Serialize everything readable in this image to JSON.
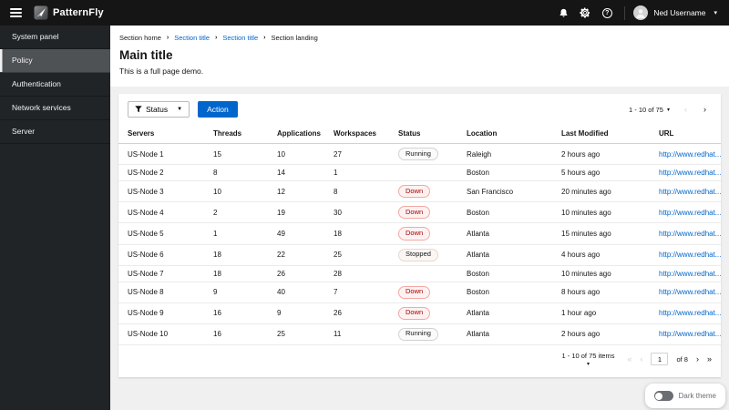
{
  "masthead": {
    "brand": "PatternFly",
    "user": {
      "name": "Ned Username"
    }
  },
  "sidebar": {
    "items": [
      {
        "label": "System panel",
        "selected": false
      },
      {
        "label": "Policy",
        "selected": true
      },
      {
        "label": "Authentication",
        "selected": false
      },
      {
        "label": "Network services",
        "selected": false
      },
      {
        "label": "Server",
        "selected": false
      }
    ]
  },
  "breadcrumb": {
    "separator": "›",
    "items": [
      {
        "label": "Section home",
        "link": false
      },
      {
        "label": "Section title",
        "link": true
      },
      {
        "label": "Section title",
        "link": true
      },
      {
        "label": "Section landing",
        "link": false
      }
    ]
  },
  "page": {
    "title": "Main title",
    "subtitle": "This is a full page demo."
  },
  "toolbar": {
    "filter_label": "Status",
    "action_label": "Action"
  },
  "pagination_top": {
    "range": "1 - 10 of 75",
    "prev": "‹",
    "next": "›"
  },
  "pagination_bottom": {
    "range": "1 - 10 of 75 items",
    "first": "«",
    "prev": "‹",
    "page": "1",
    "of_label": "of 8",
    "next": "›",
    "last": "»"
  },
  "table": {
    "columns": [
      "Servers",
      "Threads",
      "Applications",
      "Workspaces",
      "Status",
      "Location",
      "Last Modified",
      "URL"
    ],
    "rows": [
      {
        "server": "US-Node 1",
        "threads": "15",
        "applications": "10",
        "workspaces": "27",
        "status": "Running",
        "location": "Raleigh",
        "last_modified": "2 hours ago",
        "url": "http://www.redhat..."
      },
      {
        "server": "US-Node 2",
        "threads": "8",
        "applications": "14",
        "workspaces": "1",
        "status": "",
        "location": "Boston",
        "last_modified": "5 hours ago",
        "url": "http://www.redhat..."
      },
      {
        "server": "US-Node 3",
        "threads": "10",
        "applications": "12",
        "workspaces": "8",
        "status": "Down",
        "location": "San Francisco",
        "last_modified": "20 minutes ago",
        "url": "http://www.redhat..."
      },
      {
        "server": "US-Node 4",
        "threads": "2",
        "applications": "19",
        "workspaces": "30",
        "status": "Down",
        "location": "Boston",
        "last_modified": "10 minutes ago",
        "url": "http://www.redhat..."
      },
      {
        "server": "US-Node 5",
        "threads": "1",
        "applications": "49",
        "workspaces": "18",
        "status": "Down",
        "location": "Atlanta",
        "last_modified": "15 minutes ago",
        "url": "http://www.redhat..."
      },
      {
        "server": "US-Node 6",
        "threads": "18",
        "applications": "22",
        "workspaces": "25",
        "status": "Stopped",
        "location": "Atlanta",
        "last_modified": "4 hours ago",
        "url": "http://www.redhat..."
      },
      {
        "server": "US-Node 7",
        "threads": "18",
        "applications": "26",
        "workspaces": "28",
        "status": "",
        "location": "Boston",
        "last_modified": "10 minutes ago",
        "url": "http://www.redhat..."
      },
      {
        "server": "US-Node 8",
        "threads": "9",
        "applications": "40",
        "workspaces": "7",
        "status": "Down",
        "location": "Boston",
        "last_modified": "8 hours ago",
        "url": "http://www.redhat..."
      },
      {
        "server": "US-Node 9",
        "threads": "16",
        "applications": "9",
        "workspaces": "26",
        "status": "Down",
        "location": "Atlanta",
        "last_modified": "1 hour ago",
        "url": "http://www.redhat..."
      },
      {
        "server": "US-Node 10",
        "threads": "16",
        "applications": "25",
        "workspaces": "11",
        "status": "Running",
        "location": "Atlanta",
        "last_modified": "2 hours ago",
        "url": "http://www.redhat..."
      }
    ]
  },
  "status_styles": {
    "Running": {
      "text": "#151515",
      "border": "#d2d2d2",
      "bg": "#fafafa"
    },
    "Down": {
      "text": "#a30000",
      "border": "#f3a8a2",
      "bg": "#fdf2f1"
    },
    "Stopped": {
      "text": "#151515",
      "border": "#e9d7d0",
      "bg": "#fbf6f4"
    }
  },
  "theme_toggle": {
    "label": "Dark theme",
    "on": false
  },
  "colors": {
    "accent": "#0066cc",
    "masthead_bg": "#151515",
    "sidebar_bg": "#212427",
    "page_bg": "#f0f0f0"
  }
}
